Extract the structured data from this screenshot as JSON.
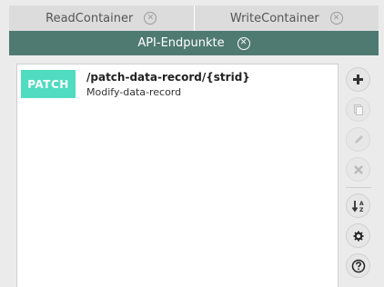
{
  "tabs": [
    {
      "label": "ReadContainer"
    },
    {
      "label": "WriteContainer"
    }
  ],
  "active_tab": {
    "label": "API-Endpunkte"
  },
  "endpoint": {
    "method": "PATCH",
    "path": "/patch-data-record/{strid}",
    "description": "Modify-data-record"
  },
  "colors": {
    "active_tab_bg": "#4f7a72",
    "patch_badge": "#4fdcc0"
  },
  "toolbar_icons": [
    "plus-icon",
    "copy-icon",
    "pencil-icon",
    "x-icon",
    "sort-az-icon",
    "gear-icon",
    "help-icon"
  ]
}
